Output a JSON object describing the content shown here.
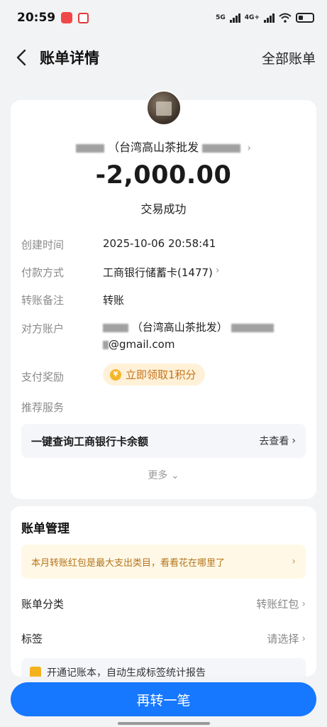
{
  "status_bar": {
    "time": "20:59",
    "net1": "5G",
    "net2": "4G+"
  },
  "nav": {
    "title": "账单详情",
    "right_label": "全部账单"
  },
  "summary": {
    "payee_text": "（台湾高山茶批发",
    "amount": "-2,000.00",
    "status": "交易成功"
  },
  "details": {
    "created_label": "创建时间",
    "created_value": "2025-10-06 20:58:41",
    "payment_label": "付款方式",
    "payment_value": "工商银行储蓄卡(1477)",
    "remark_label": "转账备注",
    "remark_value": "转账",
    "counterparty_label": "对方账户",
    "counterparty_value": "（台湾高山茶批发）",
    "counterparty_email": "@gmail.com",
    "reward_label": "支付奖励",
    "reward_value": "立即领取1积分",
    "recommend_label": "推荐服务",
    "service_text": "一键查询工商银行卡余额",
    "service_action": "去查看",
    "more_label": "更多"
  },
  "manage": {
    "title": "账单管理",
    "tip": "本月转账红包是最大支出类目，看看花在哪里了",
    "category_label": "账单分类",
    "category_value": "转账红包",
    "tag_label": "标签",
    "tag_value": "请选择",
    "peek_text": "开通记账本，自动生成标签统计报告"
  },
  "bottom_button": "再转一笔",
  "colors": {
    "primary": "#1677ff",
    "background": "#f2f3f5",
    "reward_text": "#c5731a",
    "tip_bg": "#fff8e6"
  }
}
